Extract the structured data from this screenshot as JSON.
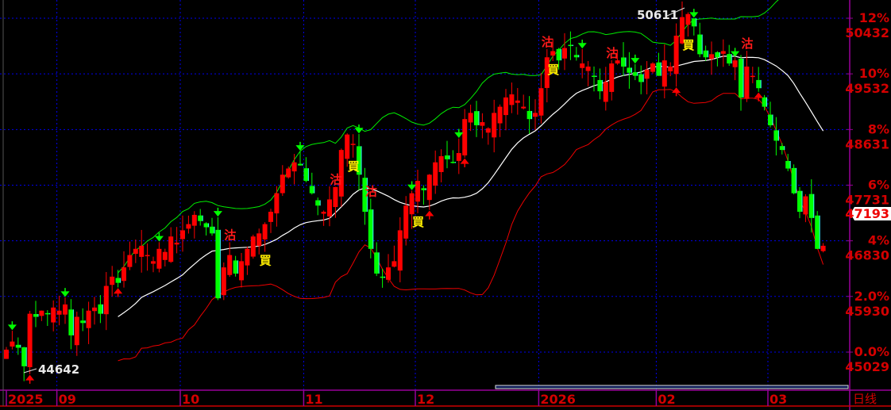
{
  "chart_data": {
    "type": "candlestick",
    "period_label": "日线",
    "base_price": 45029,
    "y_axis": [
      {
        "pct": "12%",
        "price": "50432"
      },
      {
        "pct": "10%",
        "price": "49532"
      },
      {
        "pct": "8%",
        "price": "48631"
      },
      {
        "pct": "6%",
        "price": "47731"
      },
      {
        "pct": "4%",
        "price": "46830"
      },
      {
        "pct": "2.0%",
        "price": "45930"
      },
      {
        "pct": "0.0%",
        "price": "45029"
      }
    ],
    "ylim": [
      44600,
      50850
    ],
    "current_price": "47193",
    "high_label": "50611",
    "low_label": "44642",
    "x_labels": [
      {
        "label": "2025",
        "index": 0
      },
      {
        "label": "09",
        "index": 9
      },
      {
        "label": "10",
        "index": 30
      },
      {
        "label": "11",
        "index": 51
      },
      {
        "label": "12",
        "index": 70
      },
      {
        "label": "2026",
        "index": 91
      },
      {
        "label": "02",
        "index": 111
      },
      {
        "label": "03",
        "index": 130
      }
    ],
    "closes": [
      45069,
      45200,
      45100,
      44800,
      45650,
      45600,
      45700,
      45650,
      45750,
      45700,
      45800,
      45300,
      45600,
      45500,
      45700,
      45750,
      45650,
      46100,
      46250,
      46150,
      46400,
      46600,
      46700,
      46750,
      46600,
      46500,
      46700,
      46650,
      46900,
      46800,
      47000,
      47100,
      47250,
      47150,
      47050,
      46950,
      45900,
      46400,
      46600,
      46300,
      46500,
      46700,
      46900,
      46950,
      47100,
      47300,
      47600,
      47900,
      48000,
      48100,
      48050,
      47800,
      47600,
      47400,
      47300,
      47500,
      47700,
      48300,
      48550,
      48400,
      47900,
      47300,
      46700,
      46300,
      46250,
      46400,
      46500,
      47000,
      47400,
      47600,
      47800,
      47650,
      47900,
      48100,
      48200,
      48150,
      48100,
      48250,
      48800,
      48900,
      48700,
      48750,
      48650,
      48900,
      49000,
      49150,
      49200,
      49100,
      49000,
      48800,
      48900,
      49300,
      49800,
      49900,
      49750,
      49950,
      50000,
      49800,
      49700,
      49650,
      49500,
      49250,
      49400,
      49700,
      49750,
      49650,
      49550,
      49500,
      49400,
      49600,
      49700,
      49500,
      49750,
      49650,
      50150,
      50450,
      50500,
      50300,
      49850,
      49800,
      49850,
      49800,
      49900,
      49700,
      49750,
      49150,
      49650,
      49500,
      49300,
      49000,
      48700,
      48450,
      48300,
      48000,
      47600,
      47300,
      47550,
      47200,
      46700,
      46750
    ],
    "indicators": {
      "bollinger_period": 20,
      "bollinger_k": 2
    },
    "signals": [
      {
        "index": 38,
        "type": "sell",
        "text": "沽"
      },
      {
        "index": 44,
        "type": "buy",
        "text": "買"
      },
      {
        "index": 56,
        "type": "sell",
        "text": "沽"
      },
      {
        "index": 59,
        "type": "buy",
        "text": "買"
      },
      {
        "index": 62,
        "type": "sell",
        "text": "沽"
      },
      {
        "index": 70,
        "type": "buy",
        "text": "買"
      },
      {
        "index": 92,
        "type": "sell",
        "text": "沽"
      },
      {
        "index": 93,
        "type": "buy",
        "text": "買"
      },
      {
        "index": 103,
        "type": "sell",
        "text": "沽"
      },
      {
        "index": 116,
        "type": "buy",
        "text": "買"
      },
      {
        "index": 126,
        "type": "sell",
        "text": "沽"
      }
    ],
    "arrows": [
      {
        "index": 1,
        "dir": "down"
      },
      {
        "index": 4,
        "dir": "up"
      },
      {
        "index": 10,
        "dir": "down"
      },
      {
        "index": 19,
        "dir": "up"
      },
      {
        "index": 26,
        "dir": "down"
      },
      {
        "index": 36,
        "dir": "down"
      },
      {
        "index": 50,
        "dir": "down"
      },
      {
        "index": 60,
        "dir": "down"
      },
      {
        "index": 69,
        "dir": "down"
      },
      {
        "index": 72,
        "dir": "up"
      },
      {
        "index": 77,
        "dir": "down"
      },
      {
        "index": 78,
        "dir": "up"
      },
      {
        "index": 98,
        "dir": "down"
      },
      {
        "index": 107,
        "dir": "down"
      },
      {
        "index": 114,
        "dir": "up"
      },
      {
        "index": 117,
        "dir": "down"
      },
      {
        "index": 124,
        "dir": "down"
      },
      {
        "index": 128,
        "dir": "up"
      }
    ],
    "colors": {
      "up": "#ff0000",
      "down": "#00ff00",
      "down_edge": "#33ffff",
      "upper_band": "#00ee00",
      "mid_band": "#ffffff",
      "lower_band": "#ee0000",
      "grid": "#0000ee",
      "axis": "#990099",
      "buy": "#ffee00",
      "sell": "#ff1a1a"
    }
  }
}
